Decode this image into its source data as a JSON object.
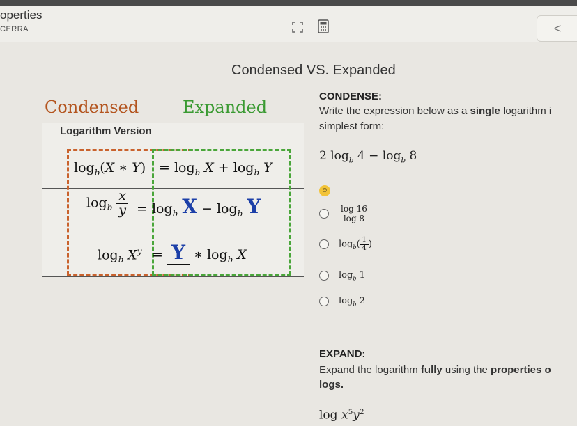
{
  "app": {
    "title": "operties",
    "subtitle": "CERRA",
    "back": "<"
  },
  "page_title": "Condensed VS. Expanded",
  "left": {
    "condensed_heading": "Condensed",
    "expanded_heading": "Expanded",
    "table_header": "Logarithm Version",
    "rows": [
      {
        "condensed": "log_b(X * Y)",
        "expanded": "= log_b X + log_b Y"
      },
      {
        "condensed": "log_b x/y",
        "expanded": "= log_b X − log_b Y"
      },
      {
        "condensed": "log_b X^y",
        "expanded": "= __Y__ * log_b X"
      }
    ]
  },
  "condense": {
    "label": "CONDENSE:",
    "instruction_pre": "Write the expression below as a ",
    "instruction_bold": "single",
    "instruction_post": " logarithm i",
    "instruction_line2": "simplest form:",
    "expression": "2 log_b 4 − log_b 8",
    "options": [
      "log 16 / log 8",
      "log_b(1/4)",
      "log_b 1",
      "log_b 2"
    ]
  },
  "expand": {
    "label": "EXPAND:",
    "instruction_pre": "Expand the logarithm ",
    "instruction_bold": "fully",
    "instruction_mid": " using the ",
    "instruction_bold2": "properties o",
    "instruction_line2": "logs.",
    "expression": "log x^5 y^2"
  }
}
